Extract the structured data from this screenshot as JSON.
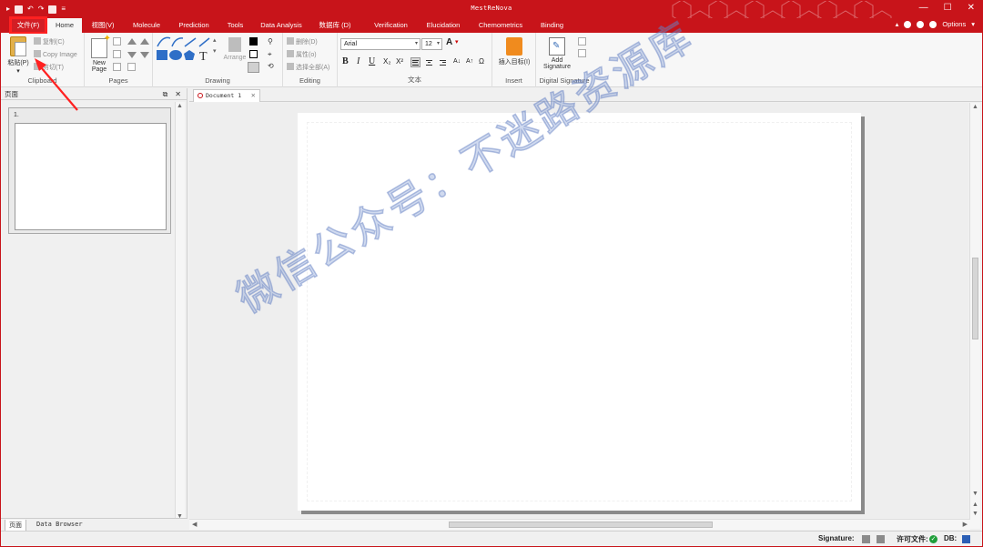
{
  "app": {
    "title": "MestReNova"
  },
  "window": {
    "min": "—",
    "max": "☐",
    "close": "✕"
  },
  "tabs": [
    {
      "label": "文件(F)"
    },
    {
      "label": "Home"
    },
    {
      "label": "视图(V)"
    },
    {
      "label": "Molecule"
    },
    {
      "label": "Prediction"
    },
    {
      "label": "Tools"
    },
    {
      "label": "Data Analysis"
    },
    {
      "label": "数据库 (D)"
    },
    {
      "label": "Verification"
    },
    {
      "label": "Elucidation"
    },
    {
      "label": "Chemometrics"
    },
    {
      "label": "Binding"
    }
  ],
  "options": {
    "label": "Options",
    "caret": "▾"
  },
  "ribbon": {
    "clipboard": {
      "paste": "粘贴(P)",
      "copy": "复制(C)",
      "copy_image": "Copy Image",
      "cut": "剪切(T)",
      "label": "Clipboard"
    },
    "pages": {
      "new_page": "New Page",
      "label": "Pages"
    },
    "drawing": {
      "arrange": "Arrange",
      "label": "Drawing"
    },
    "editing": {
      "delete": "删除(D)",
      "properties": "属性(o)",
      "select_all": "选择全部(A)",
      "label": "Editing"
    },
    "text": {
      "font": "Arial",
      "size": "12",
      "label": "文本",
      "bold": "B",
      "italic": "I",
      "underline": "U",
      "subscript": "X₂",
      "superscript": "X²"
    },
    "insert": {
      "insert_target": "插入目标(I)",
      "label": "Insert"
    },
    "signature": {
      "add": "Add Signature",
      "label": "Digital Signature"
    }
  },
  "left_pane": {
    "title": "页面",
    "page_number": "1.",
    "tabs": [
      "页面",
      "Data Browser"
    ]
  },
  "document": {
    "tab": "Document 1"
  },
  "watermark": "微信公众号：不迷路资源库",
  "status": {
    "signature": "Signature:",
    "license": "许可文件:",
    "db": "DB:"
  },
  "colors": {
    "accent": "#c8141a",
    "annotation": "#ff2020"
  },
  "icons": [
    "paste-icon",
    "copy-icon",
    "new-page-icon",
    "shapes-icon",
    "insert-target-icon",
    "add-signature-icon",
    "status-ok-icon"
  ]
}
